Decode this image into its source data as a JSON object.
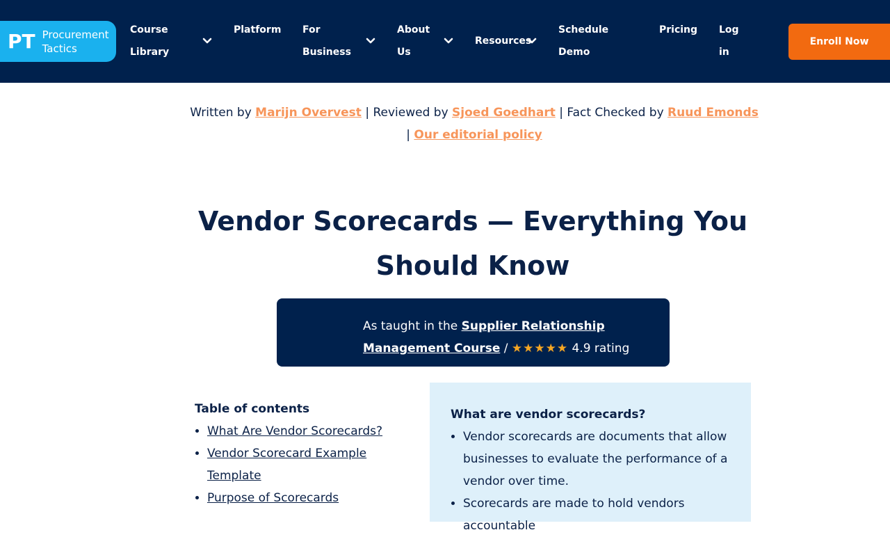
{
  "nav": {
    "logo_mark": "PT",
    "logo_line1": "Procurement",
    "logo_line2": "Tactics",
    "items": [
      {
        "line1": "Course",
        "line2": "Library"
      },
      {
        "line1": "Platform",
        "line2": ""
      },
      {
        "line1": "For",
        "line2": "Business"
      },
      {
        "line1": "About",
        "line2": "Us"
      },
      {
        "line1": "Resources",
        "line2": ""
      },
      {
        "line1": "Schedule",
        "line2": "Demo"
      },
      {
        "line1": "Pricing",
        "line2": ""
      },
      {
        "line1": "Log",
        "line2": "in"
      }
    ],
    "enroll_label": "Enroll Now",
    "enroll_color": "#f26a10",
    "bg_color": "#00214d"
  },
  "byline": {
    "written_prefix": "Written by ",
    "author": "Marijn Overvest",
    "reviewed_prefix": " | Reviewed by ",
    "reviewer": "Sjoed Goedhart",
    "checked_prefix": " | Fact Checked by ",
    "checker": "Ruud Emonds",
    "sep": "| ",
    "policy": "Our editorial policy",
    "link_color": "#f7955a"
  },
  "page": {
    "title": "Vendor Scorecards — Everything You Should Know"
  },
  "course": {
    "prefix": "As taught in the ",
    "link_line1": "Supplier Relationship",
    "link_line2": "Management Course",
    "sep": " / ",
    "stars": "★★★★★",
    "rating": " 4.9 rating"
  },
  "toc": {
    "heading": "Table of contents",
    "items": [
      "What Are Vendor Scorecards?",
      "Vendor Scorecard Example Template",
      "Purpose of Scorecards"
    ]
  },
  "summary": {
    "heading": "What are vendor scorecards?",
    "items": [
      "Vendor scorecards are documents that allow businesses to evaluate the performance of a vendor over time.",
      "Scorecards are made to hold vendors accountable"
    ]
  }
}
